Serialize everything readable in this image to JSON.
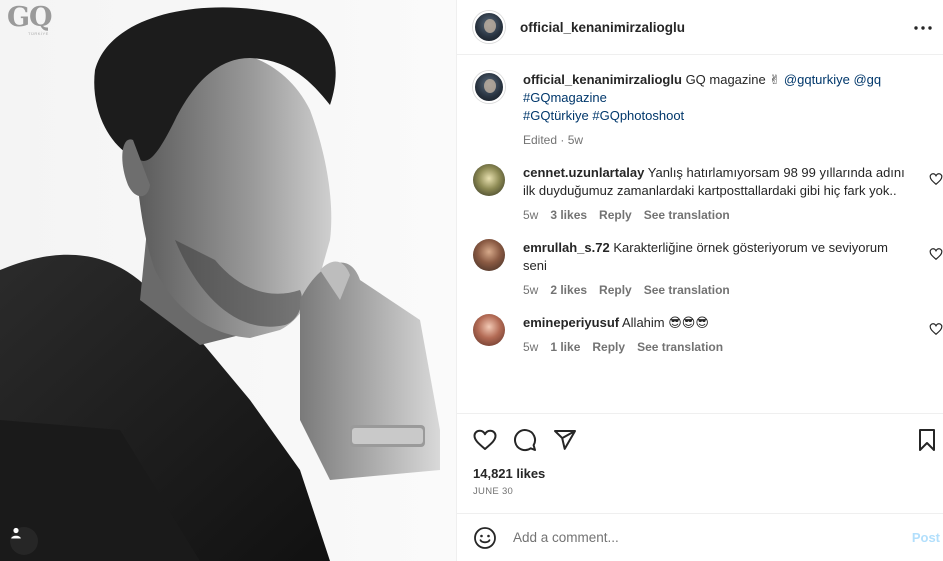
{
  "photo": {
    "brand": "GQ",
    "brand_sub": "TÜRKİYE"
  },
  "header": {
    "username": "official_kenanimirzalioglu"
  },
  "caption": {
    "username": "official_kenanimirzalioglu",
    "text": "GQ magazine ✌",
    "mentions": [
      "@gqturkiye",
      "@gq"
    ],
    "hashtags": [
      "#GQmagazine",
      "#GQtürkiye",
      "#GQphotoshoot"
    ],
    "edited": "Edited",
    "time": "5w"
  },
  "comments": [
    {
      "username": "cennet.uzunlartalay",
      "text": "Yanlış hatırlamıyorsam 98 99 yıllarında adını ilk duyduğumuz zamanlardaki kartposttallardaki gibi hiç fark yok..",
      "time": "5w",
      "likes": "3 likes",
      "reply": "Reply",
      "translate": "See translation"
    },
    {
      "username": "emrullah_s.72",
      "text": "Karakterliğine örnek gösteriyorum ve seviyorum seni",
      "time": "5w",
      "likes": "2 likes",
      "reply": "Reply",
      "translate": "See translation"
    },
    {
      "username": "emineperiyusuf",
      "text": "Allahim 😎😎😎",
      "time": "5w",
      "likes": "1 like",
      "reply": "Reply",
      "translate": "See translation"
    }
  ],
  "actions": {
    "likes": "14,821 likes",
    "date": "June 30"
  },
  "add_comment": {
    "placeholder": "Add a comment...",
    "post_label": "Post"
  }
}
